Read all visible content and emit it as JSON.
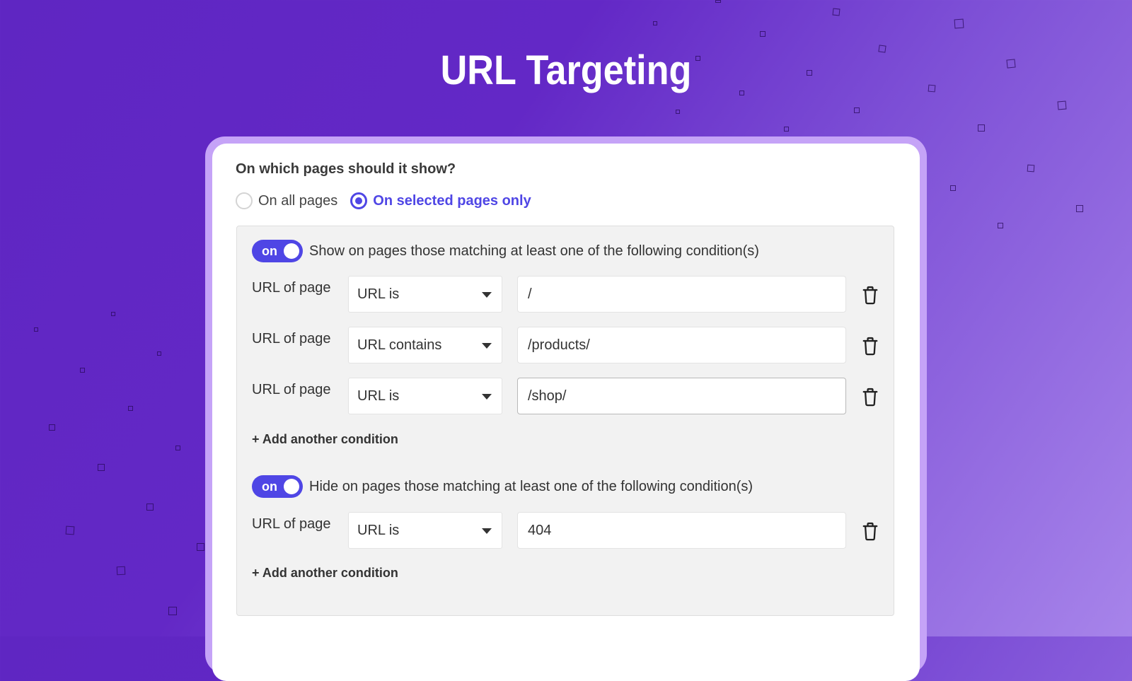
{
  "page": {
    "title": "URL Targeting"
  },
  "form": {
    "question": "On which pages should it show?",
    "radio_options": [
      {
        "label": "On all pages",
        "selected": false
      },
      {
        "label": "On selected pages only",
        "selected": true
      }
    ],
    "accent_color": "#4f46e5"
  },
  "show_section": {
    "toggle_label": "on",
    "toggle_state": true,
    "description": "Show on pages those matching at least one of the following condition(s)",
    "conditions": [
      {
        "field_label": "URL of page",
        "operator": "URL is",
        "value": "/"
      },
      {
        "field_label": "URL of page",
        "operator": "URL contains",
        "value": "/products/"
      },
      {
        "field_label": "URL of page",
        "operator": "URL is",
        "value": "/shop/"
      }
    ],
    "add_label": "+ Add another condition"
  },
  "hide_section": {
    "toggle_label": "on",
    "toggle_state": true,
    "description": "Hide on pages those matching at least one of the following condition(s)",
    "conditions": [
      {
        "field_label": "URL of page",
        "operator": "URL is",
        "value": "404"
      }
    ],
    "add_label": "+ Add another condition"
  },
  "icons": {
    "delete": "trash-icon",
    "dropdown": "caret-down-icon"
  }
}
